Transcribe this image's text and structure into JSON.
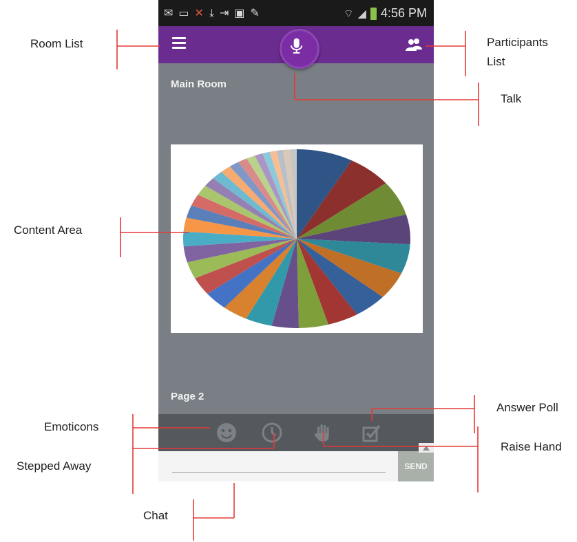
{
  "status_bar": {
    "time": "4:56 PM"
  },
  "app_bar": {
    "room_list_icon": "menu-icon",
    "talk_icon": "mic-icon",
    "participants_icon": "participants-icon"
  },
  "room": {
    "title": "Main Room",
    "page": "Page 2"
  },
  "actions": [
    {
      "id": "emoticons",
      "icon": "smiley-icon"
    },
    {
      "id": "stepped-away",
      "icon": "clock-icon"
    },
    {
      "id": "raise-hand",
      "icon": "hand-icon"
    },
    {
      "id": "answer-poll",
      "icon": "checkbox-icon"
    }
  ],
  "chat": {
    "send_label": "SEND",
    "placeholder": ""
  },
  "annotations": {
    "room_list": "Room List",
    "participants_line1": "Participants",
    "participants_line2": "List",
    "talk": "Talk",
    "content_area": "Content Area",
    "emoticons": "Emoticons",
    "stepped_away": "Stepped Away",
    "chat": "Chat",
    "answer_poll": "Answer Poll",
    "raise_hand": "Raise Hand"
  },
  "colors": {
    "app_bar": "#6b2c8f",
    "mic_button": "#7b2ea4",
    "content_bg": "#7a7e85",
    "action_bar": "#55595e",
    "callout_line": "#e53935"
  },
  "pie_slices": [
    {
      "value": 4.2,
      "color": "#2f5587"
    },
    {
      "value": 3.3,
      "color": "#8c302e"
    },
    {
      "value": 3.3,
      "color": "#6f8c34"
    },
    {
      "value": 2.8,
      "color": "#5a4479"
    },
    {
      "value": 2.8,
      "color": "#2e8897"
    },
    {
      "value": 2.6,
      "color": "#c06f27"
    },
    {
      "value": 2.5,
      "color": "#35609a"
    },
    {
      "value": 2.3,
      "color": "#a23632"
    },
    {
      "value": 2.2,
      "color": "#7f9f3a"
    },
    {
      "value": 2.0,
      "color": "#664f8a"
    },
    {
      "value": 2.0,
      "color": "#3299ab"
    },
    {
      "value": 1.9,
      "color": "#d8812e"
    },
    {
      "value": 1.8,
      "color": "#4472c4"
    },
    {
      "value": 1.7,
      "color": "#c0504d"
    },
    {
      "value": 1.6,
      "color": "#9bbb59"
    },
    {
      "value": 1.5,
      "color": "#8064a2"
    },
    {
      "value": 1.4,
      "color": "#4bacc6"
    },
    {
      "value": 1.3,
      "color": "#f79646"
    },
    {
      "value": 1.2,
      "color": "#5b7fb8"
    },
    {
      "value": 1.1,
      "color": "#d46b67"
    },
    {
      "value": 1.0,
      "color": "#a9c66e"
    },
    {
      "value": 0.9,
      "color": "#9580b3"
    },
    {
      "value": 0.85,
      "color": "#6ebbd1"
    },
    {
      "value": 0.8,
      "color": "#f7ab70"
    },
    {
      "value": 0.75,
      "color": "#7f98c8"
    },
    {
      "value": 0.7,
      "color": "#d88b88"
    },
    {
      "value": 0.65,
      "color": "#bad38c"
    },
    {
      "value": 0.6,
      "color": "#a996c4"
    },
    {
      "value": 0.55,
      "color": "#8cc9da"
    },
    {
      "value": 0.5,
      "color": "#f8bd92"
    },
    {
      "value": 0.5,
      "color": "#b9bfc9"
    },
    {
      "value": 0.5,
      "color": "#d9c9b8"
    },
    {
      "value": 0.5,
      "color": "#c6c6c6"
    }
  ]
}
